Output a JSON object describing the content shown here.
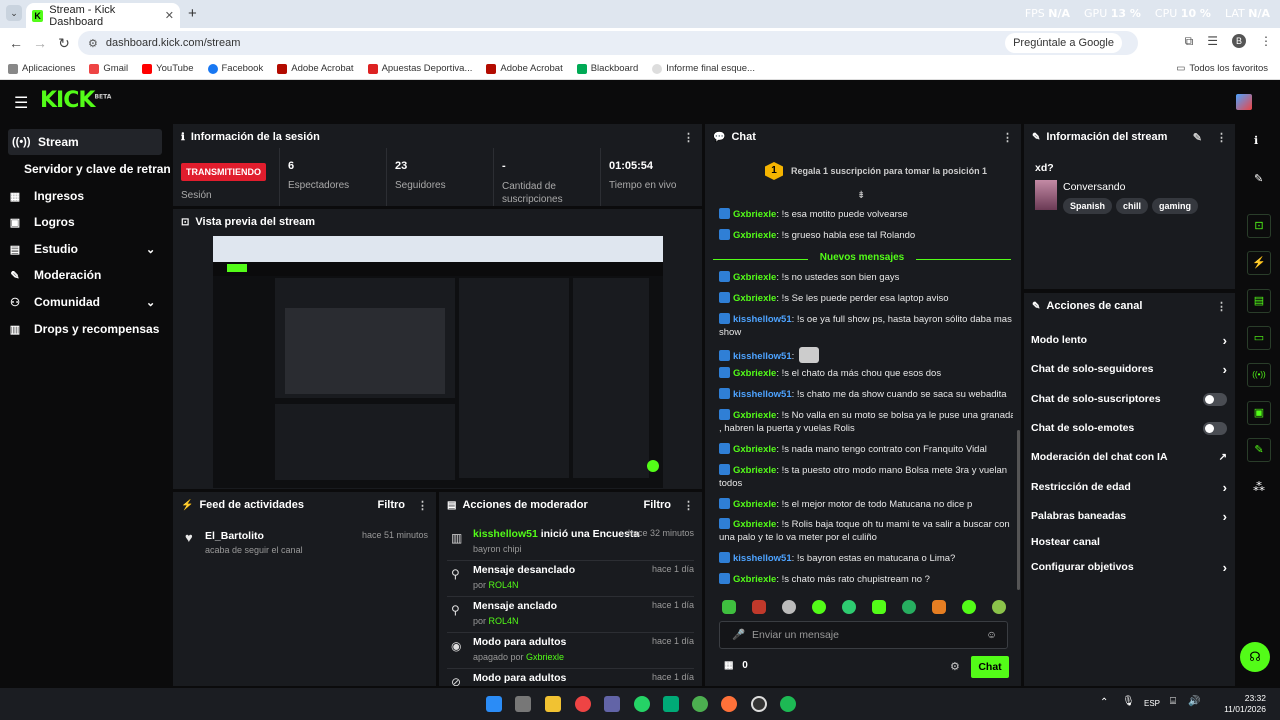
{
  "browser": {
    "tab_title": "Stream - Kick Dashboard",
    "url": "dashboard.kick.com/stream",
    "ask_google": "Pregúntale a Google",
    "profile_letter": "B",
    "perf": {
      "fps_label": "FPS",
      "fps": "N/A",
      "gpu_label": "GPU",
      "gpu": "13 %",
      "cpu_label": "CPU",
      "cpu": "10 %",
      "lat_label": "LAT",
      "lat": "N/A"
    },
    "bookmarks": [
      "Aplicaciones",
      "Gmail",
      "YouTube",
      "Facebook",
      "Adobe Acrobat",
      "Apuestas Deportiva...",
      "Adobe Acrobat",
      "Blackboard",
      "Informe final esque..."
    ],
    "all_favorites": "Todos los favoritos"
  },
  "app": {
    "logo": "KICK",
    "logo_sup": "BETA"
  },
  "sidebar": {
    "items": [
      {
        "label": "Stream",
        "icon": "broadcast-icon"
      },
      {
        "label": "Servidor y clave de retransmisión"
      },
      {
        "label": "Ingresos",
        "icon": "income-icon"
      },
      {
        "label": "Logros",
        "icon": "achievements-icon"
      },
      {
        "label": "Estudio",
        "icon": "studio-icon"
      },
      {
        "label": "Moderación",
        "icon": "wrench-icon"
      },
      {
        "label": "Comunidad",
        "icon": "community-icon"
      },
      {
        "label": "Drops y recompensas",
        "icon": "drops-icon"
      }
    ]
  },
  "session": {
    "title": "Información de la sesión",
    "status": "TRANSMITIENDO",
    "status_label": "Sesión",
    "viewers": "6",
    "viewers_label": "Espectadores",
    "followers": "23",
    "followers_label": "Seguidores",
    "subs": "-",
    "subs_label": "Cantidad de suscripciones",
    "live_time": "01:05:54",
    "live_time_label": "Tiempo en vivo"
  },
  "preview": {
    "title": "Vista previa del stream"
  },
  "activity": {
    "title": "Feed de actividades",
    "filter": "Filtro",
    "items": [
      {
        "user": "El_Bartolito",
        "action": "acaba de seguir el canal",
        "time": "hace 51 minutos"
      }
    ]
  },
  "modactions": {
    "title": "Acciones de moderador",
    "filter": "Filtro",
    "items": [
      {
        "title_user": "kisshellow51",
        "title_rest": " inició una Encuesta",
        "sub": "bayron chipi",
        "sub_prefix": "",
        "time": "hace 32 minutos",
        "icon": "poll-icon"
      },
      {
        "title": "Mensaje desanclado",
        "sub_prefix": "por ",
        "sub_user": "ROL4N",
        "time": "hace 1 día",
        "icon": "unpin-icon"
      },
      {
        "title": "Mensaje anclado",
        "sub_prefix": "por ",
        "sub_user": "ROL4N",
        "time": "hace 1 día",
        "icon": "pin-icon"
      },
      {
        "title": "Modo para adultos",
        "sub_prefix": "apagado por ",
        "sub_user": "Gxbriexle",
        "time": "hace 1 día",
        "icon": "eye-icon"
      },
      {
        "title": "Modo para adultos",
        "time": "hace 1 día",
        "icon": "eye-off-icon"
      }
    ]
  },
  "chat": {
    "title": "Chat",
    "gift_rank": "1",
    "gift_text": "Regala 1 suscripción para tomar la posición 1",
    "new_messages": "Nuevos mensajes",
    "messages": [
      {
        "user": "Gxbriexle",
        "text": " !s esa motito puede volvearse",
        "color": "green"
      },
      {
        "user": "Gxbriexle",
        "text": " !s grueso habla ese tal Rolando",
        "color": "green"
      },
      {
        "user": "Gxbriexle",
        "text": " !s no ustedes son bien gays",
        "color": "green"
      },
      {
        "user": "Gxbriexle",
        "text": " !s Se les puede perder esa laptop aviso",
        "color": "green"
      },
      {
        "user": "kisshellow51",
        "text": " !s oe ya full show ps, hasta bayron sólito daba mas show",
        "color": "blue"
      },
      {
        "user": "kisshellow51",
        "text": " ",
        "color": "blue",
        "emote": true
      },
      {
        "user": "Gxbriexle",
        "text": " !s el chato da más chou que esos dos",
        "color": "green"
      },
      {
        "user": "kisshellow51",
        "text": " !s chato me da show cuando se saca su webadita",
        "color": "blue"
      },
      {
        "user": "Gxbriexle",
        "text": " !s No valla en su moto se bolsa ya le puse una granada , habren la puerta y vuelas Rolis",
        "color": "green"
      },
      {
        "user": "Gxbriexle",
        "text": " !s nada mano tengo contrato con Franquito Vidal",
        "color": "green"
      },
      {
        "user": "Gxbriexle",
        "text": " !s ta puesto otro modo mano Bolsa mete 3ra y vuelan todos",
        "color": "green"
      },
      {
        "user": "Gxbriexle",
        "text": " !s el mejor motor de todo Matucana no dice p",
        "color": "green"
      },
      {
        "user": "Gxbriexle",
        "text": " !s Rolis baja toque oh tu mami te va salir a buscar con una palo y te lo va meter por el culiño",
        "color": "green"
      },
      {
        "user": "kisshellow51",
        "text": " !s bayron estas en matucana o Lima?",
        "color": "blue"
      },
      {
        "user": "Gxbriexle",
        "text": " !s chato más rato chupistream no ?",
        "color": "green"
      }
    ],
    "input_placeholder": "Enviar un mensaje",
    "points": "0",
    "send_label": "Chat"
  },
  "stream_info": {
    "title": "Información del stream",
    "stream_title": "xd?",
    "category": "Conversando",
    "tags": [
      "Spanish",
      "chill",
      "gaming"
    ]
  },
  "channel_actions": {
    "title": "Acciones de canal",
    "items": [
      {
        "label": "Modo lento",
        "control": "arrow"
      },
      {
        "label": "Chat de solo-seguidores",
        "control": "arrow"
      },
      {
        "label": "Chat de solo-suscriptores",
        "control": "toggle"
      },
      {
        "label": "Chat de solo-emotes",
        "control": "toggle"
      },
      {
        "label": "Moderación del chat con IA",
        "control": "external"
      },
      {
        "label": "Restricción de edad",
        "control": "arrow"
      },
      {
        "label": "Palabras baneadas",
        "control": "arrow"
      },
      {
        "label": "Hostear canal",
        "control": "none"
      },
      {
        "label": "Configurar objetivos",
        "control": "arrow"
      }
    ]
  },
  "taskbar": {
    "time": "23:32",
    "date": "11/01/2026",
    "lang": "ESP"
  },
  "colors": {
    "brand": "#53fc18",
    "live": "#e11d2d",
    "panel": "#191b1f",
    "bg": "#0b0b0c",
    "user_blue": "#4da3ff"
  }
}
